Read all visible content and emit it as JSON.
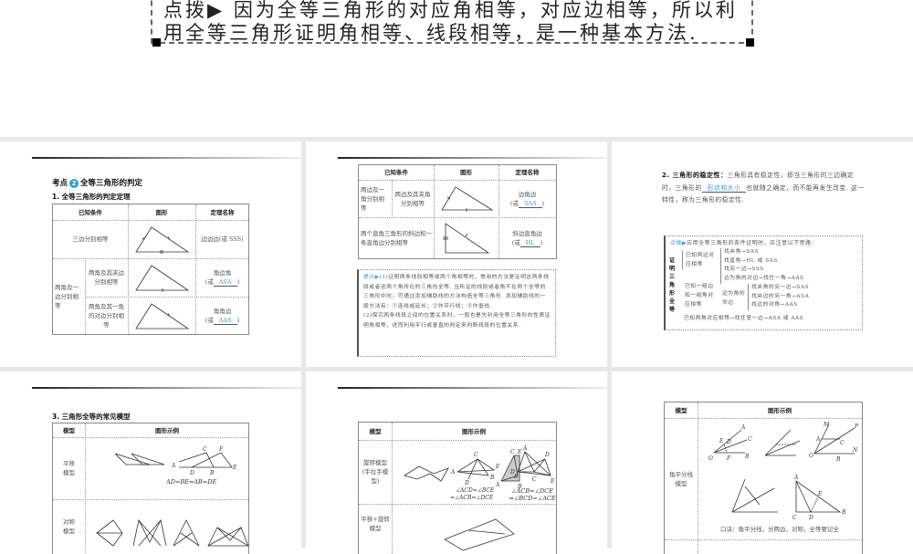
{
  "top_slide": {
    "line1": "点拨▶ 因为全等三角形的对应角相等，对应边相等，所以利",
    "line2": "用全等三角形证明角相等、线段相等，是一种基本方法."
  },
  "slide1": {
    "heading_prefix": "考点",
    "heading_num": "2",
    "heading": "全等三角形的判定",
    "subheading": "1. 全等三角形的判定定理",
    "headers": [
      "已知条件",
      "图形",
      "定理名称"
    ],
    "row1": {
      "condition": "三边分别相等",
      "name": "边边边(或 SSS)"
    },
    "group": "两角及一边分别相等",
    "row2": {
      "condition": "两角及其夹边分别相等",
      "name": "角边角",
      "prefix": "(或",
      "answer": "ASA",
      "suffix": ")"
    },
    "row3": {
      "condition": "两角及其一角的对边分别相等",
      "name": "角角边",
      "prefix": "(或",
      "answer": "AAS",
      "suffix": ")"
    }
  },
  "slide2": {
    "headers": [
      "已知条件",
      "图形",
      "定理名称"
    ],
    "row1": {
      "group": "两边及一角分别相等",
      "condition": "两边及其夹角分别相等",
      "name": "边角边",
      "prefix": "(或",
      "answer": "SAS",
      "suffix": ")"
    },
    "row2": {
      "condition": "两个直角三角形的斜边和一条直角边分别相等",
      "name": "斜边直角边",
      "prefix": "(或",
      "answer": "HL",
      "suffix": ")"
    },
    "hint_label": "提示▶",
    "hint_text1": "(1)证明两条线段相等或两个角相等时，常用的方法是证明这两条线段或者这两个角所在的三角形全等. 当所证的线段或者角不在两个全等的三角形中时，可通过添加辅助线的方法构造全等三角形. 添加辅助线的一般方法有：①连线或延长；②作平行线；③作垂线.",
    "hint_text2": "(2)探究两条线段之间的位置关系时，一般也是先利用全等三角形的性质证明角相等，进而利用平行或垂直的判定来判断线段的位置关系."
  },
  "slide3": {
    "title": "2. 三角形的稳定性：",
    "text_before": "三角形具有稳定性，即当三角形的三边确定时，三角形的",
    "answer": "形状和大小",
    "text_after": "也就随之确定，而不能再发生改变. 这一特性，称为三角形的稳定性.",
    "tip_label": "点拨▶",
    "tip_text": "应用全等三角形的条件证明时，应注意以下思路：",
    "side_label": "证明三角形全等",
    "b1": "已知两边对应相等",
    "b1_items": [
      "找夹角→SAS",
      "找直角→HL 或 SAS",
      "找另一边→SSS"
    ],
    "b2": "已知一组边和一组角对应相等",
    "b2_item1": "边为角的对边→找任一角→AAS",
    "b2_sub": "边为角的邻边",
    "b2_sub_items": [
      "找夹角的另一边→SAS",
      "找夹边的另一角→ASA",
      "找边的对角→AAS"
    ],
    "b3": "已知两角对应相等→找任意一边→ASA 或 AAS"
  },
  "slide4": {
    "subheading": "3. 三角形全等的常见模型",
    "headers": [
      "模型",
      "图形示例"
    ],
    "row1_label": "平移模型",
    "row1_labels": [
      "C",
      "F",
      "A",
      "D",
      "B",
      "E"
    ],
    "row1_formula": "AD=BE⇔AB=DE",
    "row2_label": "对称模型"
  },
  "slide5": {
    "headers": [
      "模型",
      "图形示例"
    ],
    "row1_label": "旋转模型(手拉手模型)",
    "fig_a_labels": [
      "C",
      "A",
      "E",
      "B",
      "D"
    ],
    "fig_a_formula1": "∠ACD=∠BCE",
    "fig_a_formula2": "⇔∠ACB=∠DCE",
    "fig_b_labels": [
      "C",
      "E",
      "D",
      "A",
      "B"
    ],
    "fig_c_labels": [
      "A",
      "D",
      "B",
      "C",
      "E"
    ],
    "fig_c_formula1": "∠ACB=∠DCE",
    "fig_c_formula2": "⇔∠BCD=∠ACE",
    "row2_label": "平移+旋转模型"
  },
  "slide6": {
    "headers": [
      "模型",
      "图形示例"
    ],
    "row1_label": "角平分线模型",
    "fig1_labels": [
      "A",
      "E",
      "D",
      "C",
      "O",
      "F",
      "B"
    ],
    "fig3_labels": [
      "M",
      "P",
      "A",
      "C",
      "N",
      "O",
      "B"
    ],
    "fig5_labels": [
      "A",
      "E",
      "C",
      "D",
      "B"
    ],
    "mnemonic": "口诀：角平分线，分两边，对称，全等要记全"
  }
}
